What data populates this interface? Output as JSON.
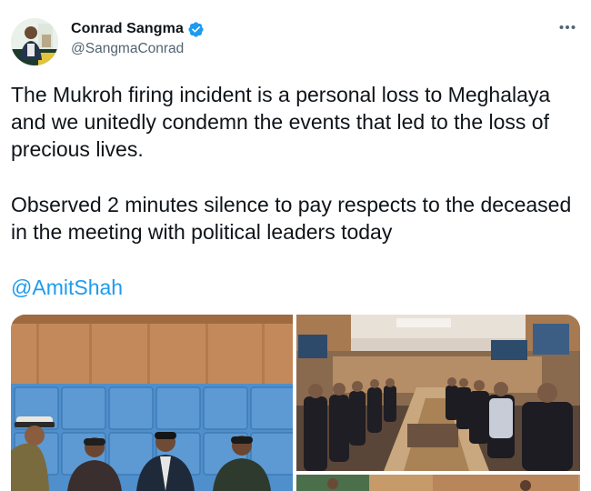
{
  "author": {
    "name": "Conrad Sangma",
    "handle": "@SangmaConrad",
    "verified": true
  },
  "icons": {
    "verified": "verified-badge-icon",
    "more": "more-options-icon"
  },
  "tweet": {
    "paragraph_1": "The Mukroh firing incident is a personal loss to Meghalaya and we unitedly condemn the events that led to the loss of precious lives.",
    "paragraph_2": "Observed 2 minutes silence to pay respects to the deceased in the meeting with political leaders today",
    "mention": "@AmitShah"
  },
  "colors": {
    "link": "#1d9bf0",
    "verified": "#1d9bf0",
    "secondary_text": "#536471"
  }
}
